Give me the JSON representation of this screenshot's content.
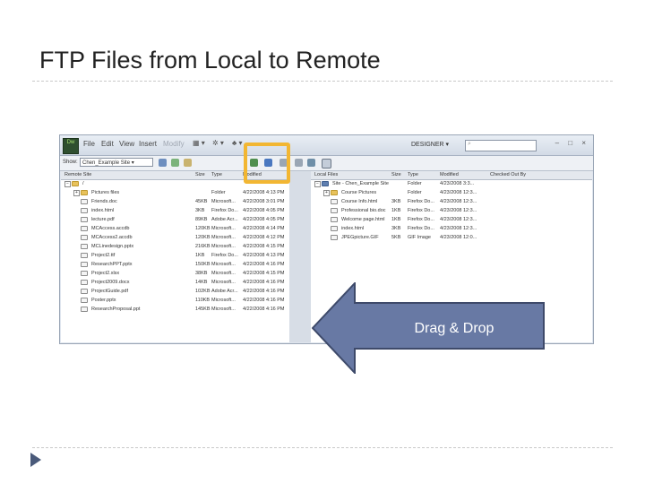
{
  "slide": {
    "title": "FTP Files from Local to Remote"
  },
  "app": {
    "logo": "Dw",
    "menus": [
      "File",
      "Edit",
      "View",
      "Insert",
      "Modify"
    ],
    "workspace_label": "DESIGNER",
    "search_placeholder": ""
  },
  "toolbar": {
    "show_label": "Show:",
    "site_name": "Chen_Example Site"
  },
  "remote": {
    "headers": {
      "name": "Remote Site",
      "size": "Size",
      "type": "Type",
      "modified": "Modified"
    },
    "root": "/",
    "files": [
      {
        "name": "Pictures files",
        "size": "",
        "type": "Folder",
        "modified": "4/22/2008 4:13 PM",
        "kind": "folder"
      },
      {
        "name": "Friends.doc",
        "size": "45KB",
        "type": "Microsoft...",
        "modified": "4/22/2008 3:01 PM",
        "kind": "doc"
      },
      {
        "name": "index.html",
        "size": "3KB",
        "type": "Firefox Do...",
        "modified": "4/22/2008 4:05 PM",
        "kind": "doc"
      },
      {
        "name": "lecture.pdf",
        "size": "89KB",
        "type": "Adobe Acr...",
        "modified": "4/22/2008 4:05 PM",
        "kind": "doc"
      },
      {
        "name": "MCAccess.accdb",
        "size": "120KB",
        "type": "Microsoft...",
        "modified": "4/22/2008 4:14 PM",
        "kind": "doc"
      },
      {
        "name": "MCAccess2.accdb",
        "size": "120KB",
        "type": "Microsoft...",
        "modified": "4/22/2008 4:12 PM",
        "kind": "doc"
      },
      {
        "name": "MCLinedesign.pptx",
        "size": "216KB",
        "type": "Microsoft...",
        "modified": "4/22/2008 4:15 PM",
        "kind": "doc"
      },
      {
        "name": "Project2.ttf",
        "size": "1KB",
        "type": "Firefox Do...",
        "modified": "4/22/2008 4:13 PM",
        "kind": "doc"
      },
      {
        "name": "ResearchPPT.pptx",
        "size": "150KB",
        "type": "Microsoft...",
        "modified": "4/22/2008 4:16 PM",
        "kind": "doc"
      },
      {
        "name": "Project2.xlsx",
        "size": "38KB",
        "type": "Microsoft...",
        "modified": "4/22/2008 4:15 PM",
        "kind": "doc"
      },
      {
        "name": "Project2009.docx",
        "size": "14KB",
        "type": "Microsoft...",
        "modified": "4/22/2008 4:16 PM",
        "kind": "doc"
      },
      {
        "name": "ProjectGuide.pdf",
        "size": "102KB",
        "type": "Adobe Acr...",
        "modified": "4/22/2008 4:16 PM",
        "kind": "doc"
      },
      {
        "name": "Poster.pptx",
        "size": "110KB",
        "type": "Microsoft...",
        "modified": "4/22/2008 4:16 PM",
        "kind": "doc"
      },
      {
        "name": "ResearchProposal.ppt",
        "size": "145KB",
        "type": "Microsoft...",
        "modified": "4/22/2008 4:16 PM",
        "kind": "doc"
      }
    ]
  },
  "local": {
    "headers": {
      "name": "Local Files",
      "size": "Size",
      "type": "Type",
      "modified": "Modified",
      "checked": "Checked Out By"
    },
    "files": [
      {
        "name": "Site - Chen_Example Site",
        "size": "",
        "type": "Folder",
        "modified": "4/23/2008 3:3...",
        "kind": "root"
      },
      {
        "name": "Course Pictures",
        "size": "",
        "type": "Folder",
        "modified": "4/23/2008 12:3...",
        "kind": "folder"
      },
      {
        "name": "Course Info.html",
        "size": "3KB",
        "type": "Firefox Do...",
        "modified": "4/23/2008 12:3...",
        "kind": "doc"
      },
      {
        "name": "Professional bio.doc",
        "size": "1KB",
        "type": "Firefox Do...",
        "modified": "4/23/2008 12:3...",
        "kind": "doc"
      },
      {
        "name": "Welcome page.html",
        "size": "1KB",
        "type": "Firefox Do...",
        "modified": "4/23/2008 12:3...",
        "kind": "doc"
      },
      {
        "name": "index.html",
        "size": "3KB",
        "type": "Firefox Do...",
        "modified": "4/23/2008 12:3...",
        "kind": "doc"
      },
      {
        "name": "JPEGpicture.GIF",
        "size": "5KB",
        "type": "GIF Image",
        "modified": "4/23/2008 12:0...",
        "kind": "doc"
      }
    ]
  },
  "callout": {
    "label": "Drag & Drop"
  },
  "colors": {
    "arrow_fill": "#6879a4",
    "arrow_stroke": "#3e4a6a",
    "highlight": "#f2b632"
  }
}
